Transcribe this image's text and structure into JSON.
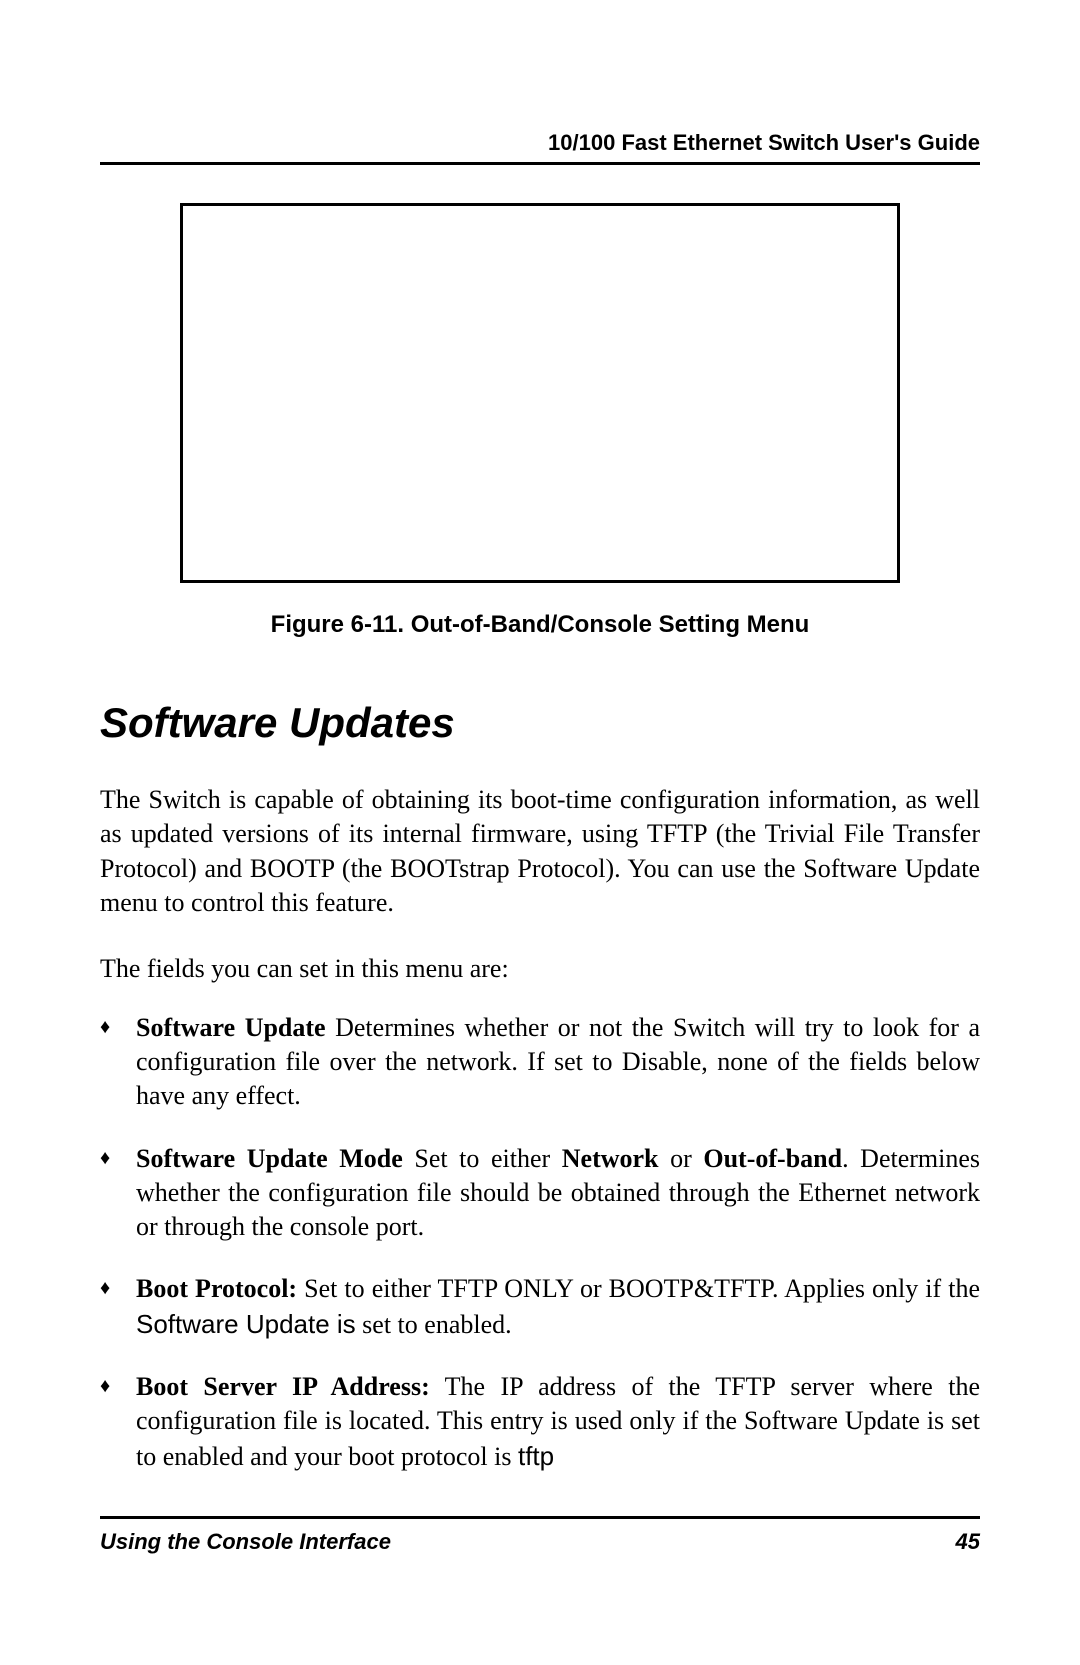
{
  "header": {
    "title": "10/100 Fast Ethernet Switch User's Guide"
  },
  "figure": {
    "caption": "Figure 6-11.  Out-of-Band/Console Setting Menu"
  },
  "section": {
    "heading": "Software Updates",
    "intro_paragraph": "The Switch is capable of obtaining its boot-time configuration information, as well as updated versions of its internal firmware, using TFTP (the Trivial File Transfer Protocol) and BOOTP (the BOOTstrap Protocol).  You can use the Software Update menu to control this feature.",
    "fields_intro": "The fields you can set in this menu are:"
  },
  "bullets": [
    {
      "term": "Software Update",
      "rest": " Determines whether or not the Switch will try to look for a configuration file over the network.  If set to Disable, none of the fields below have any effect."
    },
    {
      "term": "Software Update Mode",
      "seg1": "  Set to either ",
      "b1": "Network",
      "seg2": " or ",
      "b2": "Out-of-band",
      "seg3": ". Determines whether the configuration file should be obtained through the Ethernet network or through the console port."
    },
    {
      "term": "Boot Protocol:",
      "seg1": "  Set to either TFTP ONLY or  BOOTP&TFTP. Applies only if the ",
      "sans1": "Software Update is",
      "seg2": " set to enabled."
    },
    {
      "term": "Boot Server IP Address:",
      "seg1": "  The IP address of the TFTP server where the configuration file is located. This entry is used only if the Software Update is set to enabled and your boot protocol is ",
      "sans1": "tftp"
    }
  ],
  "footer": {
    "left": "Using the Console Interface",
    "page": "45"
  }
}
